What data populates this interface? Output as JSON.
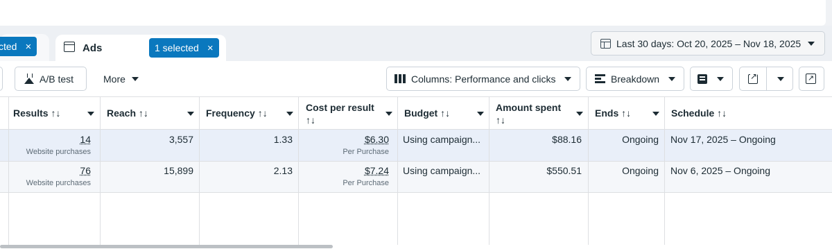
{
  "tabs": {
    "left_pill": "cted",
    "ads_label": "Ads",
    "ads_pill": "1 selected"
  },
  "date_range": "Last 30 days: Oct 20, 2025 – Nov 18, 2025",
  "toolbar": {
    "ab_test": "A/B test",
    "more": "More",
    "columns": "Columns: Performance and clicks",
    "breakdown": "Breakdown"
  },
  "icons": {
    "close": "×",
    "sort": "↑↓"
  },
  "table": {
    "headers": {
      "results": "Results",
      "reach": "Reach",
      "frequency": "Frequency",
      "cost_line1": "Cost per result",
      "budget": "Budget",
      "amount_line1": "Amount spent",
      "ends": "Ends",
      "schedule": "Schedule"
    },
    "rows": [
      {
        "results": "14",
        "results_sub": "Website purchases",
        "reach": "3,557",
        "frequency": "1.33",
        "cost": "$6.30",
        "cost_sub": "Per Purchase",
        "budget": "Using campaign...",
        "amount": "$88.16",
        "ends": "Ongoing",
        "schedule": "Nov 17, 2025 – Ongoing"
      },
      {
        "results": "76",
        "results_sub": "Website purchases",
        "reach": "15,899",
        "frequency": "2.13",
        "cost": "$7.24",
        "cost_sub": "Per Purchase",
        "budget": "Using campaign...",
        "amount": "$550.51",
        "ends": "Ongoing",
        "schedule": "Nov 6, 2025 – Ongoing"
      }
    ]
  },
  "colors": {
    "accent": "#0a78be",
    "selected_row": "#e9eff9",
    "border": "#dddfe2"
  }
}
